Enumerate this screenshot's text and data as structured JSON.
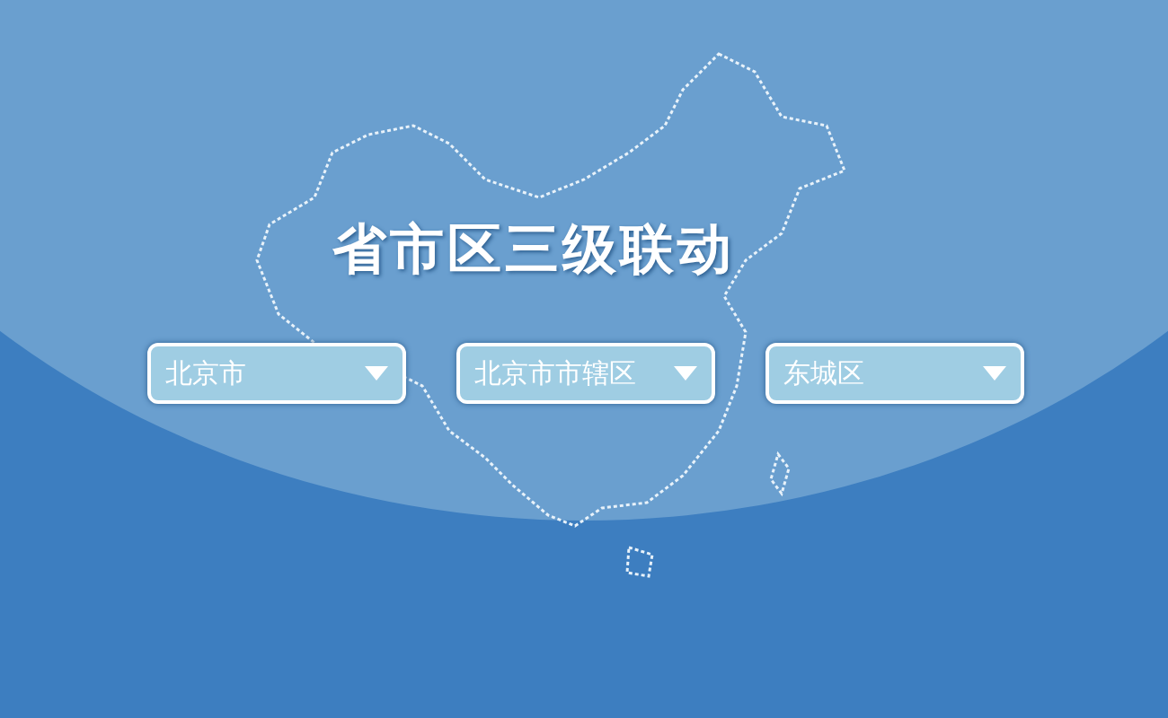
{
  "title": "省市区三级联动",
  "selects": [
    {
      "value": "北京市"
    },
    {
      "value": "北京市市辖区"
    },
    {
      "value": "东城区"
    }
  ]
}
